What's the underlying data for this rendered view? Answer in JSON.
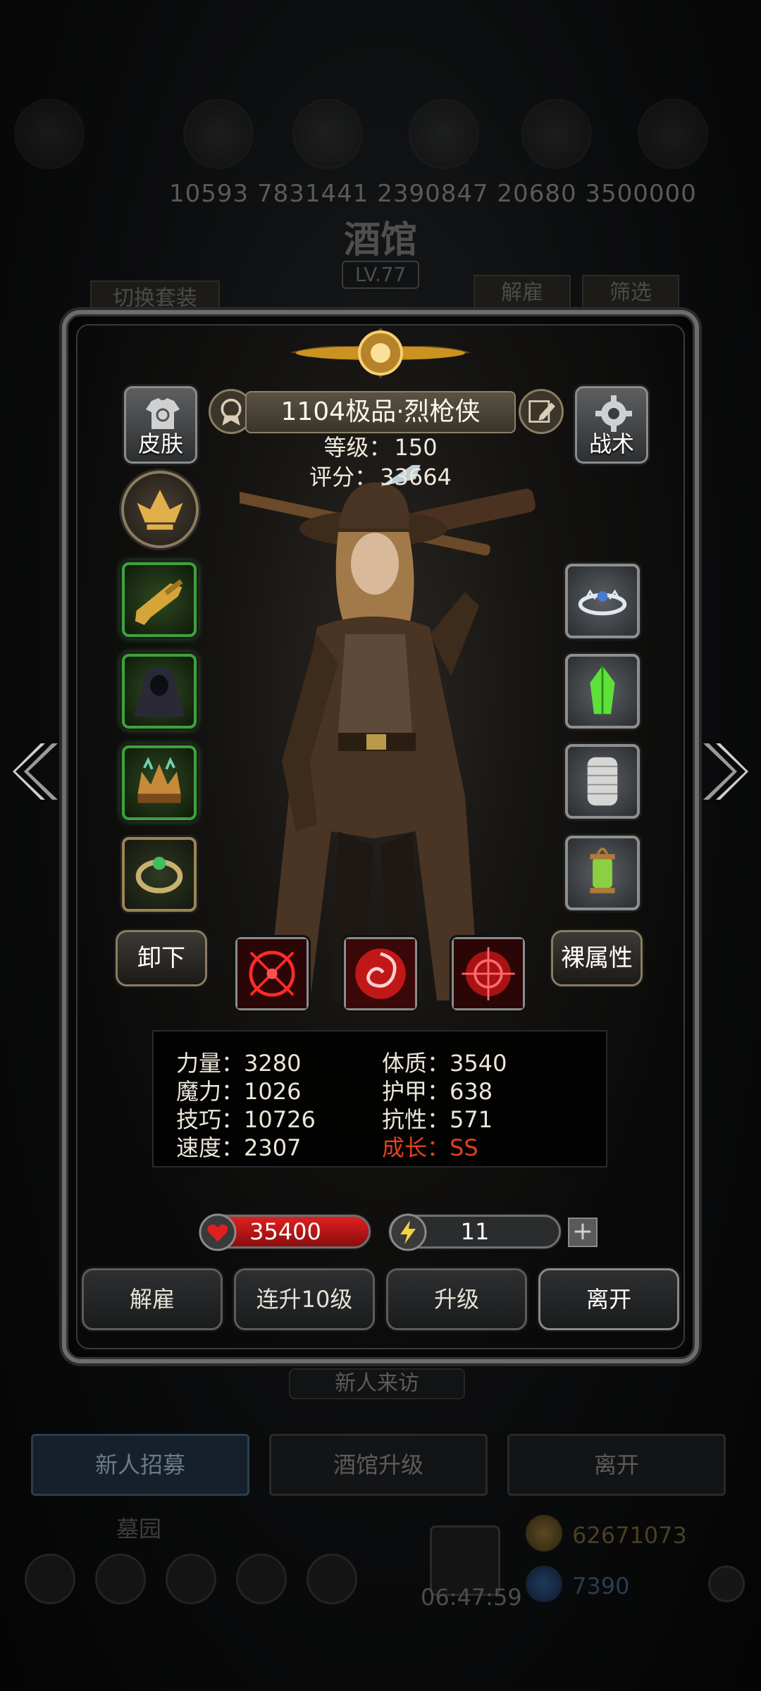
{
  "background": {
    "resource_numbers": "10593   7831441  2390847  20680  3500000",
    "title": "酒馆",
    "level": "LV.77",
    "switch_outfit": "切换套装",
    "dismiss": "解雇",
    "filter": "筛选",
    "new_visitor": "新人来访",
    "tabs": [
      "新人招募",
      "酒馆升级",
      "离开"
    ],
    "graveyard": "墓园",
    "timer": "06:47:59",
    "gold": "62671073",
    "gems": "7390"
  },
  "hero": {
    "name": "1104极品·烈枪侠",
    "level_label": "等级：",
    "level": "150",
    "score_label": "评分：",
    "score": "33664",
    "skin_label": "皮肤",
    "tactics_label": "战术"
  },
  "equipment_left": [
    {
      "icon": "golden-gun-icon",
      "quality": "green"
    },
    {
      "icon": "hooded-cloak-icon",
      "quality": "green"
    },
    {
      "icon": "spiked-crown-icon",
      "quality": "green"
    },
    {
      "icon": "jade-ring-icon",
      "quality": "gold"
    }
  ],
  "equipment_right": [
    {
      "icon": "tiara-icon",
      "quality": "gray"
    },
    {
      "icon": "green-crystal-icon",
      "quality": "gray"
    },
    {
      "icon": "chainmail-icon",
      "quality": "gray"
    },
    {
      "icon": "lantern-icon",
      "quality": "gray"
    }
  ],
  "actions": {
    "unequip": "卸下",
    "base_attributes": "裸属性"
  },
  "skills": [
    "crosshair-skill-icon",
    "swirl-skill-icon",
    "target-skill-icon"
  ],
  "stats": {
    "strength": "力量：3280",
    "magic": "魔力：1026",
    "skill": "技巧：10726",
    "speed": "速度：2307",
    "constitution": "体质：3540",
    "armor": "护甲：638",
    "resistance": "抗性：571",
    "growth": "成长：SS"
  },
  "bars": {
    "hp": "35400",
    "energy": "11",
    "energy_fraction": 0.07,
    "plus": "+"
  },
  "dialog_buttons": [
    "解雇",
    "连升10级",
    "升级",
    "离开"
  ],
  "colors": {
    "growth": "#e0401e",
    "hp": "#e02020",
    "energy": "#f2d340",
    "green_quality": "#3ea23a"
  }
}
